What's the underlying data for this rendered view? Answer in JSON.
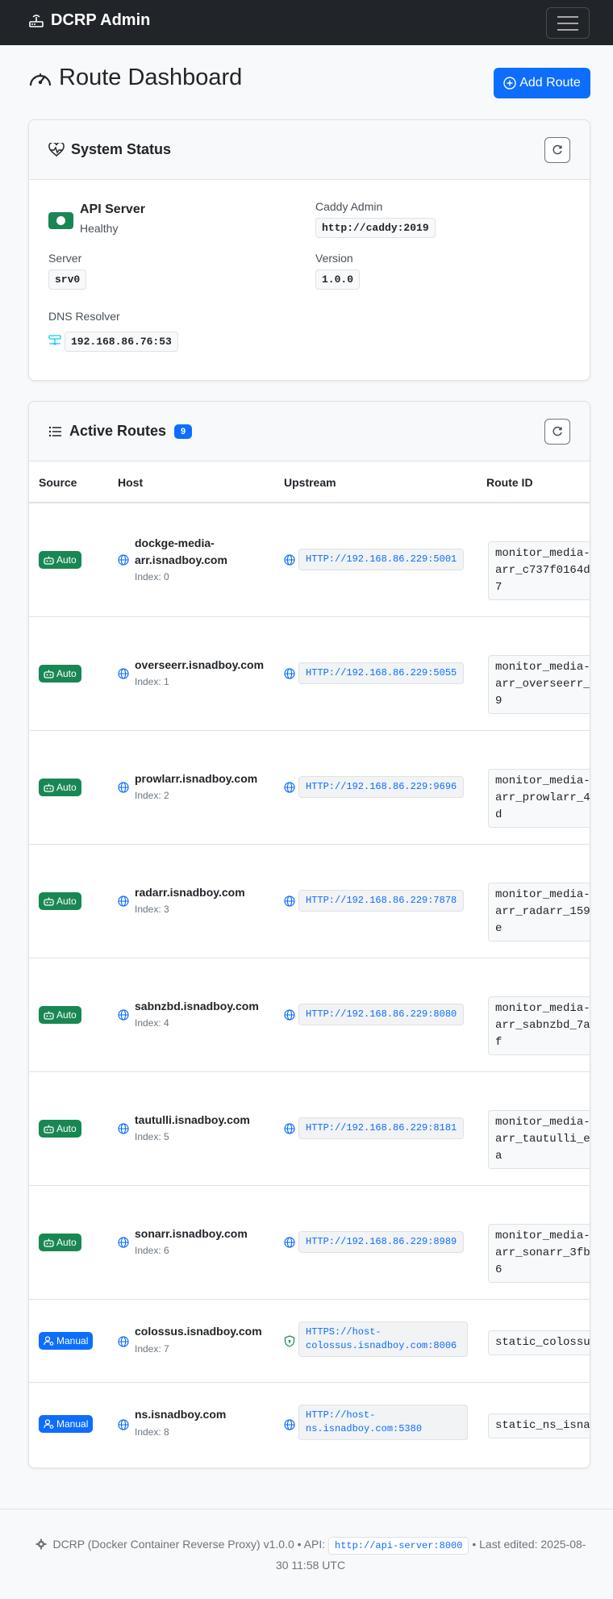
{
  "navbar": {
    "brand": "DCRP Admin",
    "brand_icon": "router-icon",
    "menu_icon": "hamburger-icon"
  },
  "page": {
    "title": "Route Dashboard",
    "title_icon": "speedometer-icon",
    "add_button": "Add Route"
  },
  "system_status": {
    "title": "System Status",
    "api_server_label": "API Server",
    "api_server_status": "Healthy",
    "caddy_admin_label": "Caddy Admin",
    "caddy_admin_value": "http://caddy:2019",
    "server_label": "Server",
    "server_value": "srv0",
    "version_label": "Version",
    "version_value": "1.0.0",
    "dns_label": "DNS Resolver",
    "dns_value": "192.168.86.76:53"
  },
  "routes": {
    "title": "Active Routes",
    "count": "9",
    "columns": [
      "Source",
      "Host",
      "Upstream",
      "Route ID"
    ],
    "rows": [
      {
        "source": "Auto",
        "host": "dockge-media-arr.isnadboy.com",
        "index": "Index: 0",
        "upstream": "HTTP://192.168.86.229:5001",
        "route_id": "monitor_media-arr_c737f0164d7"
      },
      {
        "source": "Auto",
        "host": "overseerr.isnadboy.com",
        "index": "Index: 1",
        "upstream": "HTTP://192.168.86.229:5055",
        "route_id": "monitor_media-arr_overseerr_9"
      },
      {
        "source": "Auto",
        "host": "prowlarr.isnadboy.com",
        "index": "Index: 2",
        "upstream": "HTTP://192.168.86.229:9696",
        "route_id": "monitor_media-arr_prowlarr_4d"
      },
      {
        "source": "Auto",
        "host": "radarr.isnadboy.com",
        "index": "Index: 3",
        "upstream": "HTTP://192.168.86.229:7878",
        "route_id": "monitor_media-arr_radarr_159e"
      },
      {
        "source": "Auto",
        "host": "sabnzbd.isnadboy.com",
        "index": "Index: 4",
        "upstream": "HTTP://192.168.86.229:8080",
        "route_id": "monitor_media-arr_sabnzbd_7af"
      },
      {
        "source": "Auto",
        "host": "tautulli.isnadboy.com",
        "index": "Index: 5",
        "upstream": "HTTP://192.168.86.229:8181",
        "route_id": "monitor_media-arr_tautulli_ea"
      },
      {
        "source": "Auto",
        "host": "sonarr.isnadboy.com",
        "index": "Index: 6",
        "upstream": "HTTP://192.168.86.229:8989",
        "route_id": "monitor_media-arr_sonarr_3fb6"
      },
      {
        "source": "Manual",
        "host": "colossus.isnadboy.com",
        "index": "Index: 7",
        "upstream": "HTTPS://host-colossus.isnadboy.com:8006",
        "route_id": "static_colossus"
      },
      {
        "source": "Manual",
        "host": "ns.isnadboy.com",
        "index": "Index: 8",
        "upstream": "HTTP://host-ns.isnadboy.com:5380",
        "route_id": "static_ns_isna"
      }
    ]
  },
  "footer": {
    "text_before": "DCRP (Docker Container Reverse Proxy) v1.0.0 • API:",
    "api_url": "http://api-server:8000",
    "text_after": "• Last edited: 2025-08-30 11:58 UTC"
  }
}
